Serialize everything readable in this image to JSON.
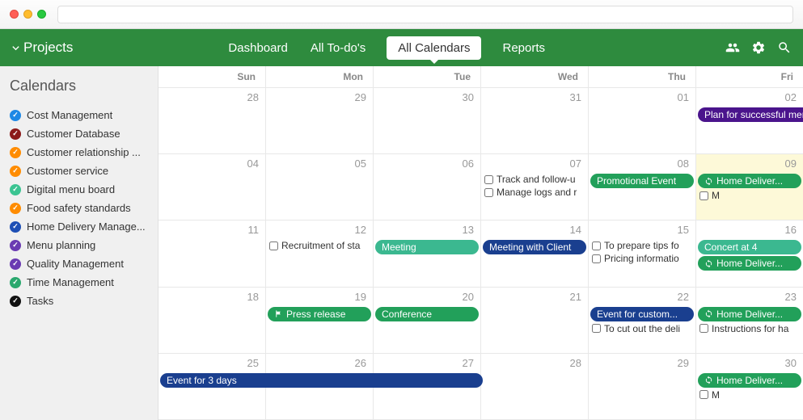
{
  "nav": {
    "projects_label": "Projects",
    "tabs": [
      "Dashboard",
      "All To-do's",
      "All Calendars",
      "Reports"
    ],
    "active_tab": "All Calendars"
  },
  "sidebar": {
    "title": "Calendars",
    "items": [
      {
        "label": "Cost Management",
        "color": "#1e88e5"
      },
      {
        "label": "Customer Database",
        "color": "#8b1a1a"
      },
      {
        "label": "Customer relationship ...",
        "color": "#ff8c00"
      },
      {
        "label": "Customer service",
        "color": "#ff8c00"
      },
      {
        "label": "Digital menu board",
        "color": "#3bc492"
      },
      {
        "label": "Food safety standards",
        "color": "#ff8c00"
      },
      {
        "label": "Home Delivery Manage...",
        "color": "#1e4fb5"
      },
      {
        "label": "Menu planning",
        "color": "#6a3ab2"
      },
      {
        "label": "Quality Management",
        "color": "#6a3ab2"
      },
      {
        "label": "Time Management",
        "color": "#2aa86e"
      },
      {
        "label": "Tasks",
        "color": "#111"
      }
    ]
  },
  "calendar": {
    "weekdays": [
      "Sun",
      "Mon",
      "Tue",
      "Wed",
      "Thu",
      "Fri"
    ],
    "weeks": [
      {
        "days": [
          {
            "n": "28"
          },
          {
            "n": "29"
          },
          {
            "n": "30"
          },
          {
            "n": "31"
          },
          {
            "n": "01"
          },
          {
            "n": "02",
            "pills": [
              {
                "text": "Plan for successful menu pl",
                "bg": "#4a148c",
                "span": "right"
              }
            ]
          }
        ]
      },
      {
        "days": [
          {
            "n": "04"
          },
          {
            "n": "05"
          },
          {
            "n": "06"
          },
          {
            "n": "07",
            "tasks": [
              "Track and follow-u",
              "Manage logs and r"
            ]
          },
          {
            "n": "08",
            "pills": [
              {
                "text": "Promotional Event",
                "bg": "#22a05a"
              }
            ]
          },
          {
            "n": "09",
            "highlight": true,
            "pills": [
              {
                "text": "Home Deliver...",
                "bg": "#22a05a",
                "icon": "repeat"
              }
            ],
            "tasks": [
              "M"
            ]
          }
        ]
      },
      {
        "days": [
          {
            "n": "11"
          },
          {
            "n": "12",
            "tasks": [
              "Recruitment of sta"
            ]
          },
          {
            "n": "13",
            "pills": [
              {
                "text": "Meeting",
                "bg": "#3bb890"
              }
            ]
          },
          {
            "n": "14",
            "pills": [
              {
                "text": "Meeting with Client",
                "bg": "#1a3f8f"
              }
            ]
          },
          {
            "n": "15",
            "tasks": [
              "To prepare tips fo",
              "Pricing informatio"
            ]
          },
          {
            "n": "16",
            "pills": [
              {
                "text": "Concert at 4",
                "bg": "#3bb890"
              },
              {
                "text": "Home Deliver...",
                "bg": "#22a05a",
                "icon": "repeat"
              }
            ]
          }
        ]
      },
      {
        "days": [
          {
            "n": "18"
          },
          {
            "n": "19",
            "pills": [
              {
                "text": "Press release",
                "bg": "#22a05a",
                "icon": "flag"
              }
            ]
          },
          {
            "n": "20",
            "pills": [
              {
                "text": "Conference",
                "bg": "#22a05a"
              }
            ]
          },
          {
            "n": "21"
          },
          {
            "n": "22",
            "pills": [
              {
                "text": "Event for custom...",
                "bg": "#1a3f8f"
              }
            ],
            "tasks": [
              "To cut out the deli"
            ]
          },
          {
            "n": "23",
            "pills": [
              {
                "text": "Home Deliver...",
                "bg": "#22a05a",
                "icon": "repeat"
              }
            ],
            "tasks": [
              "Instructions for ha"
            ]
          }
        ]
      },
      {
        "days": [
          {
            "n": "25",
            "span_pill": {
              "text": "Event for 3 days",
              "bg": "#1a3f8f",
              "start": 0,
              "end": 3
            }
          },
          {
            "n": "26"
          },
          {
            "n": "27"
          },
          {
            "n": "28"
          },
          {
            "n": "29"
          },
          {
            "n": "30",
            "pills": [
              {
                "text": "Home Deliver...",
                "bg": "#22a05a",
                "icon": "repeat"
              }
            ],
            "tasks": [
              "M"
            ]
          }
        ]
      }
    ]
  }
}
